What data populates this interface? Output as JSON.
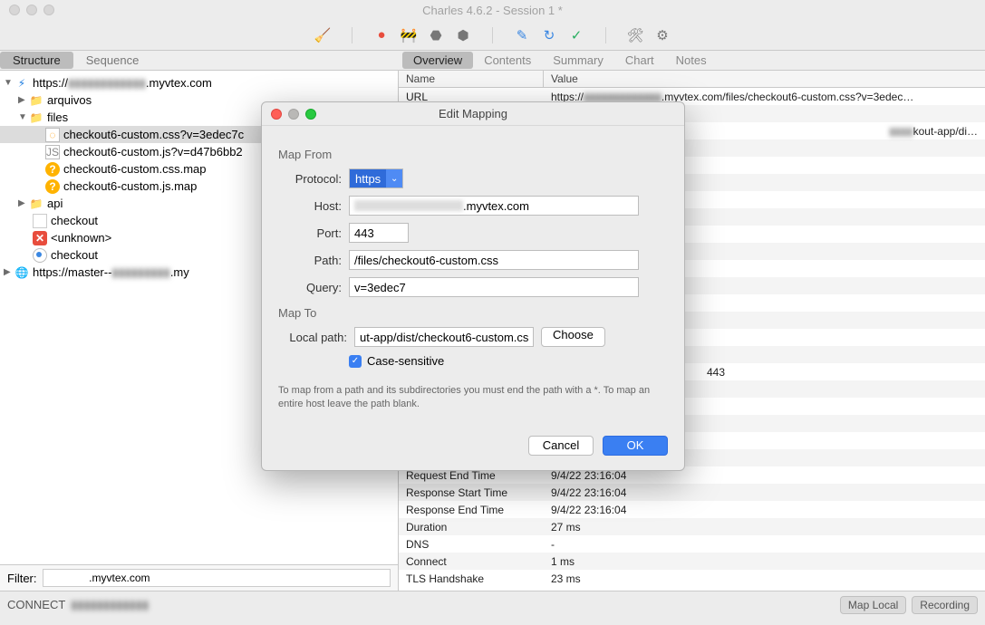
{
  "window": {
    "title": "Charles 4.6.2 - Session 1 *"
  },
  "left_tabs": {
    "structure": "Structure",
    "sequence": "Sequence"
  },
  "right_tabs": {
    "overview": "Overview",
    "contents": "Contents",
    "summary": "Summary",
    "chart": "Chart",
    "notes": "Notes"
  },
  "tree": {
    "host_suffix": ".myvtex.com",
    "folders": {
      "arquivos": "arquivos",
      "files": "files",
      "api": "api"
    },
    "items": {
      "css": "checkout6-custom.css?v=3edec7c",
      "js": "checkout6-custom.js?v=d47b6bb2",
      "cssmap": "checkout6-custom.css.map",
      "jsmap": "checkout6-custom.js.map",
      "checkout1": "checkout",
      "unknown": "<unknown>",
      "checkout2": "checkout",
      "other_host_prefix": "https://master--",
      "other_host_suffix": ".my"
    }
  },
  "filter": {
    "label": "Filter:",
    "suffix": ".myvtex.com"
  },
  "overview": {
    "columns": {
      "name": "Name",
      "value": "Value"
    },
    "url_label": "URL",
    "url_value_prefix": "https://",
    "url_value_suffix": ".myvtex.com/files/checkout6-custom.css?v=3edec…",
    "app_suffix": "kout-app/di…",
    "port_val": "443",
    "rows": [
      {
        "n": "Request End Time",
        "v": "9/4/22 23:16:04"
      },
      {
        "n": "Response Start Time",
        "v": "9/4/22 23:16:04"
      },
      {
        "n": "Response End Time",
        "v": "9/4/22 23:16:04"
      },
      {
        "n": "Duration",
        "v": "27 ms"
      },
      {
        "n": "DNS",
        "v": "-"
      },
      {
        "n": "Connect",
        "v": "1 ms"
      },
      {
        "n": "TLS Handshake",
        "v": "23 ms"
      }
    ]
  },
  "status": {
    "connect": "CONNECT",
    "map_local": "Map Local",
    "recording": "Recording"
  },
  "modal": {
    "title": "Edit Mapping",
    "map_from": "Map From",
    "map_to": "Map To",
    "labels": {
      "protocol": "Protocol:",
      "host": "Host:",
      "port": "Port:",
      "path": "Path:",
      "query": "Query:",
      "local_path": "Local path:"
    },
    "values": {
      "protocol": "https",
      "host_suffix": ".myvtex.com",
      "port": "443",
      "path": "/files/checkout6-custom.css",
      "query": "v=3edec7",
      "local_path": "ut-app/dist/checkout6-custom.css"
    },
    "choose": "Choose",
    "case_sensitive": "Case-sensitive",
    "hint": "To map from a path and its subdirectories you must end the path with a *. To map an entire host leave the path blank.",
    "cancel": "Cancel",
    "ok": "OK"
  }
}
